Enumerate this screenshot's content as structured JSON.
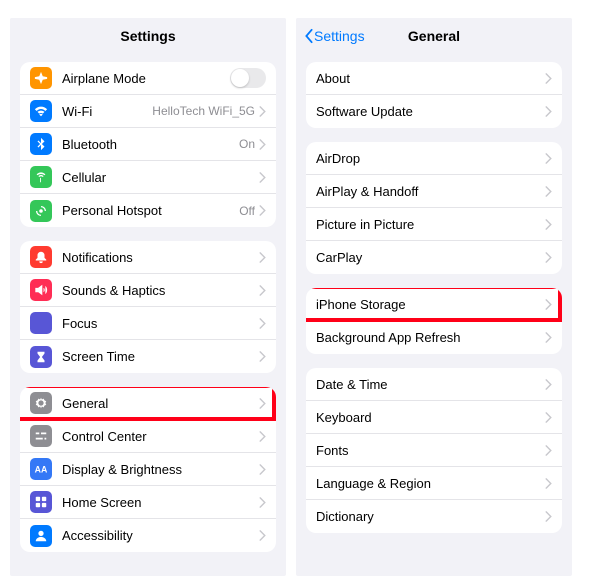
{
  "left": {
    "title": "Settings",
    "groups": [
      [
        {
          "icon": "airplane",
          "color": "bg-orange",
          "label": "Airplane Mode",
          "type": "toggle"
        },
        {
          "icon": "wifi",
          "color": "bg-blue",
          "label": "Wi-Fi",
          "value": "HelloTech WiFi_5G",
          "type": "link"
        },
        {
          "icon": "bluetooth",
          "color": "bg-blue",
          "label": "Bluetooth",
          "value": "On",
          "type": "link"
        },
        {
          "icon": "cellular",
          "color": "bg-green",
          "label": "Cellular",
          "type": "link"
        },
        {
          "icon": "hotspot",
          "color": "bg-green",
          "label": "Personal Hotspot",
          "value": "Off",
          "type": "link"
        }
      ],
      [
        {
          "icon": "bell",
          "color": "bg-red",
          "label": "Notifications",
          "type": "link"
        },
        {
          "icon": "speaker",
          "color": "bg-pink",
          "label": "Sounds & Haptics",
          "type": "link"
        },
        {
          "icon": "moon",
          "color": "bg-indigo",
          "label": "Focus",
          "type": "link"
        },
        {
          "icon": "hourglass",
          "color": "bg-indigo",
          "label": "Screen Time",
          "type": "link"
        }
      ],
      [
        {
          "icon": "gear",
          "color": "bg-gray",
          "label": "General",
          "type": "link",
          "highlight": true
        },
        {
          "icon": "sliders",
          "color": "bg-gray",
          "label": "Control Center",
          "type": "link"
        },
        {
          "icon": "aa",
          "color": "bg-darkblue",
          "label": "Display & Brightness",
          "type": "link"
        },
        {
          "icon": "grid",
          "color": "bg-purple",
          "label": "Home Screen",
          "type": "link"
        },
        {
          "icon": "person",
          "color": "bg-blue",
          "label": "Accessibility",
          "type": "link"
        }
      ]
    ]
  },
  "right": {
    "back": "Settings",
    "title": "General",
    "groups": [
      [
        {
          "label": "About",
          "type": "link"
        },
        {
          "label": "Software Update",
          "type": "link"
        }
      ],
      [
        {
          "label": "AirDrop",
          "type": "link"
        },
        {
          "label": "AirPlay & Handoff",
          "type": "link"
        },
        {
          "label": "Picture in Picture",
          "type": "link"
        },
        {
          "label": "CarPlay",
          "type": "link"
        }
      ],
      [
        {
          "label": "iPhone Storage",
          "type": "link",
          "highlight": true
        },
        {
          "label": "Background App Refresh",
          "type": "link"
        }
      ],
      [
        {
          "label": "Date & Time",
          "type": "link"
        },
        {
          "label": "Keyboard",
          "type": "link"
        },
        {
          "label": "Fonts",
          "type": "link"
        },
        {
          "label": "Language & Region",
          "type": "link"
        },
        {
          "label": "Dictionary",
          "type": "link"
        }
      ]
    ]
  }
}
